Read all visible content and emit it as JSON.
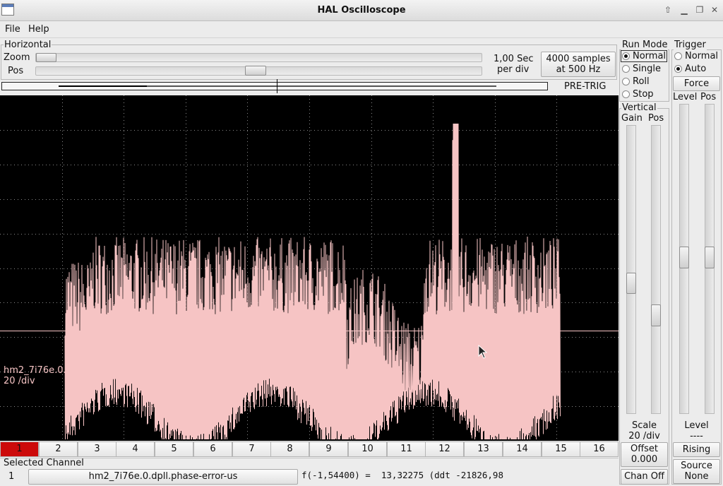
{
  "window": {
    "title": "HAL Oscilloscope"
  },
  "menu": {
    "file": "File",
    "help": "Help"
  },
  "horizontal": {
    "label": "Horizontal",
    "zoom_label": "Zoom",
    "pos_label": "Pos",
    "rate_line1": "1,00 Sec",
    "rate_line2": "per div",
    "samples_line1": "4000 samples",
    "samples_line2": "at 500 Hz",
    "pretrig": "PRE-TRIG"
  },
  "run_mode": {
    "label": "Run Mode",
    "options": [
      "Normal",
      "Single",
      "Roll",
      "Stop"
    ],
    "selected": "Normal"
  },
  "trigger": {
    "label": "Trigger",
    "options": [
      "Normal",
      "Auto"
    ],
    "selected": "Auto",
    "force": "Force",
    "level_label": "Level",
    "pos_label": "Pos",
    "level_caption": "Level",
    "level_value": "----",
    "edge": "Rising",
    "source_line1": "Source",
    "source_line2": "None"
  },
  "vertical": {
    "label": "Vertical",
    "gain_label": "Gain",
    "pos_label": "Pos",
    "scale_caption": "Scale",
    "scale_value": "20 /div",
    "offset_caption": "Offset",
    "offset_value": "0.000",
    "chan_off": "Chan Off"
  },
  "channels": [
    "1",
    "2",
    "3",
    "4",
    "5",
    "6",
    "7",
    "8",
    "9",
    "10",
    "11",
    "12",
    "13",
    "14",
    "15",
    "16"
  ],
  "selected_channel": {
    "label": "Selected Channel",
    "number": "1",
    "signal": "hm2_7i76e.0.dpll.phase-error-us",
    "readout": "f(-1,54400) =  13,32275 (ddt -21826,98"
  },
  "scope_overlay": {
    "line1": "hm2_7i76e.0.dpll.phase-error-us",
    "line2": "20 /div"
  },
  "colors": {
    "trace": "#f6c4c4",
    "selected_channel": "#cc0a0a",
    "grid": "#8a8a8a",
    "background": "#000000"
  }
}
